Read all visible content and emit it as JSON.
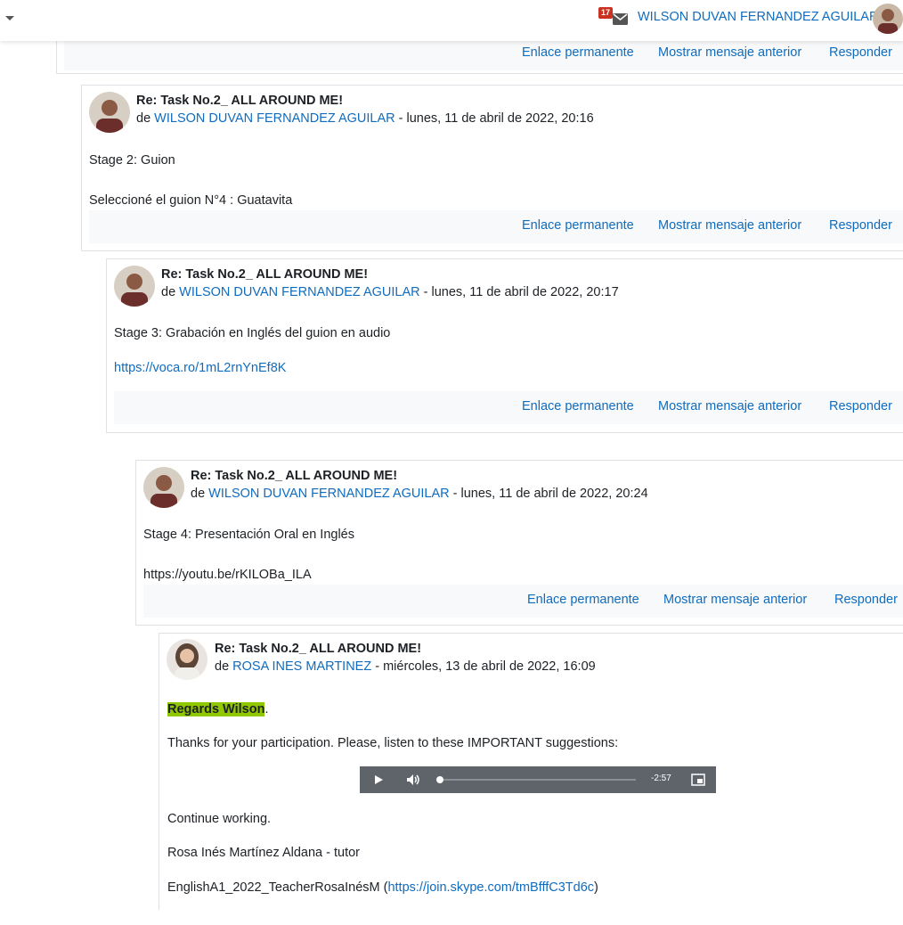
{
  "header": {
    "notification_count": "17",
    "user_name": "WILSON DUVAN FERNANDEZ AGUILAR"
  },
  "actions": {
    "permalink": "Enlace permanente",
    "show_parent": "Mostrar mensaje anterior",
    "reply": "Responder"
  },
  "posts": [
    {
      "subject": "Re: Task No.2_ ALL AROUND ME!",
      "by": "de",
      "author": "WILSON DUVAN FERNANDEZ AGUILAR",
      "date": " - lunes, 11 de abril de 2022, 20:16",
      "lines": [
        "Stage 2: Guion",
        "Seleccioné el guion N°4 : Guatavita"
      ]
    },
    {
      "subject": "Re: Task No.2_ ALL AROUND ME!",
      "by": "de",
      "author": "WILSON DUVAN FERNANDEZ AGUILAR",
      "date": " - lunes, 11 de abril de 2022, 20:17",
      "lines": [
        "Stage 3: Grabación en Inglés del guion en audio"
      ],
      "link": "https://voca.ro/1mL2rnYnEf8K"
    },
    {
      "subject": "Re: Task No.2_ ALL AROUND ME!",
      "by": "de",
      "author": "WILSON DUVAN FERNANDEZ AGUILAR",
      "date": " - lunes, 11 de abril de 2022, 20:24",
      "lines": [
        "Stage 4: Presentación Oral en Inglés",
        "https://youtu.be/rKILOBa_ILA"
      ]
    },
    {
      "subject": "Re: Task No.2_ ALL AROUND ME!",
      "by": "de",
      "author": "ROSA INES MARTINEZ",
      "date": " - miércoles, 13 de abril de 2022, 16:09",
      "highlight": "Regards Wilson",
      "highlight_after": ".",
      "lines": [
        "Thanks for your participation. Please, listen to these IMPORTANT suggestions:",
        "Continue working.",
        "Rosa Inés Martínez Aldana - tutor"
      ],
      "sign_prefix": "EnglishA1_2022_TeacherRosaInésM (",
      "sign_link": "https://join.skype.com/tmBfffC3Td6c",
      "sign_suffix": ")",
      "audio_time": "-2:57",
      "audio_progress": 0
    }
  ],
  "colors": {
    "link": "#0f6cbf",
    "badge": "#ca3120",
    "highlight": "#8fc700",
    "audio_bar": "#5f646b"
  },
  "icons": [
    "caret-down-icon",
    "mail-icon",
    "play-icon",
    "volume-icon",
    "picture-in-picture-icon"
  ]
}
